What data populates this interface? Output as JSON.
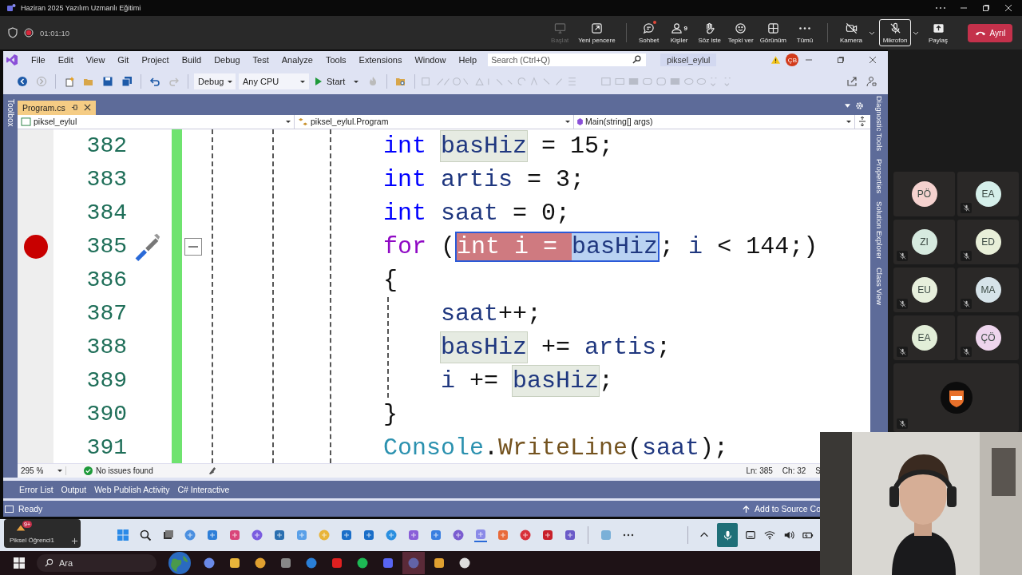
{
  "app_window": {
    "title": "Haziran 2025 Yazılım Uzmanlı Eğitimi"
  },
  "meeting_bar": {
    "recording": true,
    "elapsed": "01:01:10",
    "buttons": [
      {
        "label": "Başlat",
        "disabled": true,
        "unread": false
      },
      {
        "label": "Yeni pencere",
        "disabled": false,
        "unread": false
      },
      {
        "label": "Sohbet",
        "disabled": false,
        "unread": true
      },
      {
        "label": "Kişiler",
        "disabled": false,
        "unread": false,
        "count": "9"
      },
      {
        "label": "Söz iste",
        "disabled": false,
        "unread": false
      },
      {
        "label": "Tepki ver",
        "disabled": false,
        "unread": false
      },
      {
        "label": "Görünüm",
        "disabled": false,
        "unread": false
      },
      {
        "label": "Tümü",
        "disabled": false,
        "unread": false
      }
    ],
    "devices": [
      {
        "label": "Kamera",
        "selected": false
      },
      {
        "label": "Mikrofon",
        "selected": true
      }
    ],
    "share": "Paylaş",
    "leave": "Ayrıl"
  },
  "vs": {
    "menu": [
      "File",
      "Edit",
      "View",
      "Git",
      "Project",
      "Build",
      "Debug",
      "Test",
      "Analyze",
      "Tools",
      "Extensions",
      "Window",
      "Help"
    ],
    "search": {
      "placeholder": "Search (Ctrl+Q)"
    },
    "solution": "piksel_eylul",
    "user_initials": "ÇB",
    "toolbar": {
      "configuration": "Debug",
      "platform": "Any CPU",
      "start": "Start"
    },
    "left_strip": "Toolbox",
    "document_tab": {
      "label": "Program.cs",
      "selected": true
    },
    "nav": [
      "piksel_eylul",
      "piksel_eylul.Program",
      "Main(string[] args)"
    ],
    "editor": {
      "lines": [
        {
          "number": "382",
          "breakpoint": false,
          "quick_action": false,
          "collapsible": false,
          "tokens": [
            {
              "text": "int ",
              "kind": "keyword",
              "selected": false,
              "highlighted": false
            },
            {
              "text": "basHiz",
              "kind": "name",
              "selected": false,
              "highlighted": true
            },
            {
              "text": " = ",
              "kind": "text",
              "selected": false,
              "highlighted": false
            },
            {
              "text": "15",
              "kind": "number",
              "selected": false,
              "highlighted": false
            },
            {
              "text": ";",
              "kind": "text",
              "selected": false,
              "highlighted": false
            }
          ]
        },
        {
          "number": "383",
          "breakpoint": false,
          "quick_action": false,
          "collapsible": false,
          "tokens": [
            {
              "text": "int ",
              "kind": "keyword",
              "selected": false,
              "highlighted": false
            },
            {
              "text": "artis",
              "kind": "name",
              "selected": false,
              "highlighted": false
            },
            {
              "text": " = ",
              "kind": "text",
              "selected": false,
              "highlighted": false
            },
            {
              "text": "3",
              "kind": "number",
              "selected": false,
              "highlighted": false
            },
            {
              "text": ";",
              "kind": "text",
              "selected": false,
              "highlighted": false
            }
          ]
        },
        {
          "number": "384",
          "breakpoint": false,
          "quick_action": false,
          "collapsible": false,
          "tokens": [
            {
              "text": "int ",
              "kind": "keyword",
              "selected": false,
              "highlighted": false
            },
            {
              "text": "saat",
              "kind": "name",
              "selected": false,
              "highlighted": false
            },
            {
              "text": " = ",
              "kind": "text",
              "selected": false,
              "highlighted": false
            },
            {
              "text": "0",
              "kind": "number",
              "selected": false,
              "highlighted": false
            },
            {
              "text": ";",
              "kind": "text",
              "selected": false,
              "highlighted": false
            }
          ]
        },
        {
          "number": "385",
          "breakpoint": true,
          "quick_action": true,
          "collapsible": true,
          "tokens": [
            {
              "text": "for ",
              "kind": "control",
              "selected": false,
              "highlighted": false
            },
            {
              "text": "(",
              "kind": "text",
              "selected": false,
              "highlighted": false
            },
            {
              "text": "int ",
              "kind": "keyword",
              "selected": true,
              "highlighted": false
            },
            {
              "text": "i = ",
              "kind": "text",
              "selected": true,
              "highlighted": false
            },
            {
              "text": "basHiz",
              "kind": "name",
              "selected": true,
              "highlighted": true
            },
            {
              "text": "; ",
              "kind": "text",
              "selected": false,
              "highlighted": false
            },
            {
              "text": "i",
              "kind": "name",
              "selected": false,
              "highlighted": false
            },
            {
              "text": " < ",
              "kind": "text",
              "selected": false,
              "highlighted": false
            },
            {
              "text": "144",
              "kind": "number",
              "selected": false,
              "highlighted": false
            },
            {
              "text": ";)",
              "kind": "text",
              "selected": false,
              "highlighted": false
            }
          ]
        },
        {
          "number": "386",
          "breakpoint": false,
          "quick_action": false,
          "collapsible": false,
          "tokens": [
            {
              "text": "{",
              "kind": "text",
              "selected": false,
              "highlighted": false
            }
          ],
          "children": [
            {
              "number": "387",
              "breakpoint": false,
              "quick_action": false,
              "collapsible": false,
              "tokens": [
                {
                  "text": "saat",
                  "kind": "name",
                  "selected": false,
                  "highlighted": false
                },
                {
                  "text": "++;",
                  "kind": "text",
                  "selected": false,
                  "highlighted": false
                }
              ]
            },
            {
              "number": "388",
              "breakpoint": false,
              "quick_action": false,
              "collapsible": false,
              "tokens": [
                {
                  "text": "basHiz",
                  "kind": "name",
                  "selected": false,
                  "highlighted": true
                },
                {
                  "text": " += ",
                  "kind": "text",
                  "selected": false,
                  "highlighted": false
                },
                {
                  "text": "artis",
                  "kind": "name",
                  "selected": false,
                  "highlighted": false
                },
                {
                  "text": ";",
                  "kind": "text",
                  "selected": false,
                  "highlighted": false
                }
              ]
            },
            {
              "number": "389",
              "breakpoint": false,
              "quick_action": false,
              "collapsible": false,
              "tokens": [
                {
                  "text": "i",
                  "kind": "name",
                  "selected": false,
                  "highlighted": false
                },
                {
                  "text": " += ",
                  "kind": "text",
                  "selected": false,
                  "highlighted": false
                },
                {
                  "text": "basHiz",
                  "kind": "name",
                  "selected": false,
                  "highlighted": true
                },
                {
                  "text": ";",
                  "kind": "text",
                  "selected": false,
                  "highlighted": false
                }
              ]
            }
          ]
        },
        {
          "number": "390",
          "breakpoint": false,
          "quick_action": false,
          "collapsible": false,
          "tokens": [
            {
              "text": "}",
              "kind": "text",
              "selected": false,
              "highlighted": false
            }
          ]
        },
        {
          "number": "391",
          "breakpoint": false,
          "quick_action": false,
          "collapsible": false,
          "tokens": [
            {
              "text": "Console",
              "kind": "type",
              "selected": false,
              "highlighted": false
            },
            {
              "text": ".",
              "kind": "text",
              "selected": false,
              "highlighted": false
            },
            {
              "text": "WriteLine",
              "kind": "method",
              "selected": false,
              "highlighted": false
            },
            {
              "text": "(",
              "kind": "text",
              "selected": false,
              "highlighted": false
            },
            {
              "text": "saat",
              "kind": "name",
              "selected": false,
              "highlighted": false
            },
            {
              "text": ");",
              "kind": "text",
              "selected": false,
              "highlighted": false
            }
          ]
        }
      ]
    },
    "editor_status": {
      "zoom": "295 %",
      "issues": "No issues found",
      "line": "Ln: 385",
      "column": "Ch: 32",
      "column_3": "S"
    },
    "right_strip": [
      "Diagnostic Tools",
      "Properties",
      "Solution Explorer",
      "Class View"
    ],
    "bottom_tabs": [
      "Error List",
      "Output",
      "Web Publish Activity",
      "C# Interactive"
    ],
    "status": {
      "text": "Ready",
      "source_control": "Add to Source Co"
    }
  },
  "presenter_tile": {
    "name": "Piksel Öğrenci1",
    "badge": "9+"
  },
  "participants": [
    {
      "kind": "initials",
      "initials": "PÖ",
      "color": "#f5d2cf",
      "muted": false
    },
    {
      "kind": "initials",
      "initials": "EA",
      "color": "#d5efea",
      "muted": true
    },
    {
      "kind": "initials",
      "initials": "ZI",
      "color": "#d6eadf",
      "muted": true
    },
    {
      "kind": "initials",
      "initials": "ED",
      "color": "#e8efd8",
      "muted": true
    },
    {
      "kind": "initials",
      "initials": "EU",
      "color": "#e7efdc",
      "muted": true
    },
    {
      "kind": "initials",
      "initials": "MA",
      "color": "#d6e3e9",
      "muted": true
    },
    {
      "kind": "initials",
      "initials": "EA",
      "color": "#e2eed8",
      "muted": true
    },
    {
      "kind": "initials",
      "initials": "ÇÖ",
      "color": "#eed5ed",
      "muted": true
    },
    {
      "kind": "logo",
      "muted": true
    }
  ],
  "taskbar": {
    "search": {
      "placeholder": "Ara"
    }
  }
}
